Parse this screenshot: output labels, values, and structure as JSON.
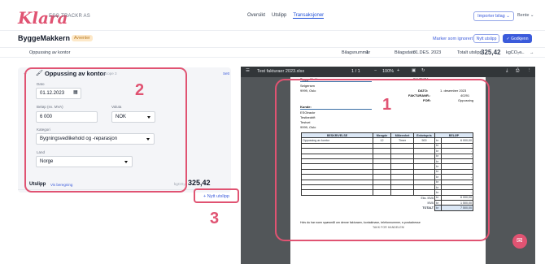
{
  "header": {
    "logo": "Klara",
    "company": "ESG.TRACKR AS",
    "nav": [
      "Oversikt",
      "Utslipp",
      "Transaksjoner"
    ],
    "import_button": "Importer bilag ⌄",
    "user": "Bente ⌄"
  },
  "subheader": {
    "title": "ByggeMakkern",
    "badge": "Avventer",
    "mark_seen": "Marker som ignorert",
    "new_expense": "Nytt utslipp",
    "approve": "✓ Godkjenn"
  },
  "infobar": {
    "item": "Oppussing av kontor",
    "voucher_label": "Bilagsnummer",
    "voucher_value": "1",
    "date_label": "Bilagsdato",
    "date_value": "01.DES. 2023",
    "total_label": "Totalt utslipp",
    "total_value": "325,42",
    "total_unit": "kgCO₂e"
  },
  "card": {
    "title": "Oppussing av kontor",
    "scope": "Scope 3",
    "top_right": "Sett",
    "date_label": "Dato",
    "date_value": "01.12.2023",
    "amount_label": "Beløp (ex. MVA)",
    "amount_value": "6 000",
    "currency_label": "Valuta",
    "currency_value": "NOK",
    "category_label": "Kategori",
    "category_value": "Bygningsvedlikehold og -reparasjon",
    "country_label": "Land",
    "country_value": "Norge"
  },
  "emission": {
    "label": "Utslipp",
    "link": "Vis beregning",
    "unit": "kgCO₂e",
    "value": "325,42"
  },
  "new_line": "+ Nytt utslipp",
  "callouts": [
    "1",
    "2",
    "3"
  ],
  "viewer": {
    "filename": "Test fakturaer 2023.xlsx",
    "page": "1 / 1",
    "zoom": "100%"
  },
  "invoice": {
    "seller": "ByggeMakkern",
    "seller_addr1": "Selgersen",
    "seller_addr2": "9999, Oslo",
    "title": "FAKTURA",
    "date_label": "DATO:",
    "date_value": "1. desember 2023",
    "invoice_no_label": "FAKTURANR.:",
    "invoice_no_value": "40291",
    "for_label": "FOR:",
    "for_value": "Oppussing",
    "customer_label": "Kunde:",
    "customer_lines": [
      "ESGtrackr",
      "Testbedrift",
      "Testvei",
      "9999, Oslo"
    ],
    "columns": [
      "BESKRIVELSE",
      "Mengde",
      "Måleenhet",
      "Enhetspris",
      "BELØP"
    ],
    "row_desc": "Oppussing av kontor",
    "row_qty": "12",
    "row_unit": "Timer",
    "row_price": "500",
    "row_cur": "kr",
    "row_amount": "6 000,00",
    "empty_amount": "-",
    "sum_lines": [
      {
        "label": "Eks. MVA",
        "cur": "kr",
        "value": "6 000,00"
      },
      {
        "label": "MVA",
        "cur": "kr",
        "value": "1 500,00"
      },
      {
        "label": "TOTALT",
        "cur": "kr",
        "value": "7 500,00"
      }
    ],
    "footer1": "Hvis du har noen spørsmål om denne fakturaen, kontaktnavn, telefonnummer, e-postadresse",
    "footer2": "TAKK FOR HANDELEN!"
  },
  "colors": {
    "accent": "#3b5bdb",
    "highlight": "#e05372",
    "badge": "#fde8c8"
  }
}
